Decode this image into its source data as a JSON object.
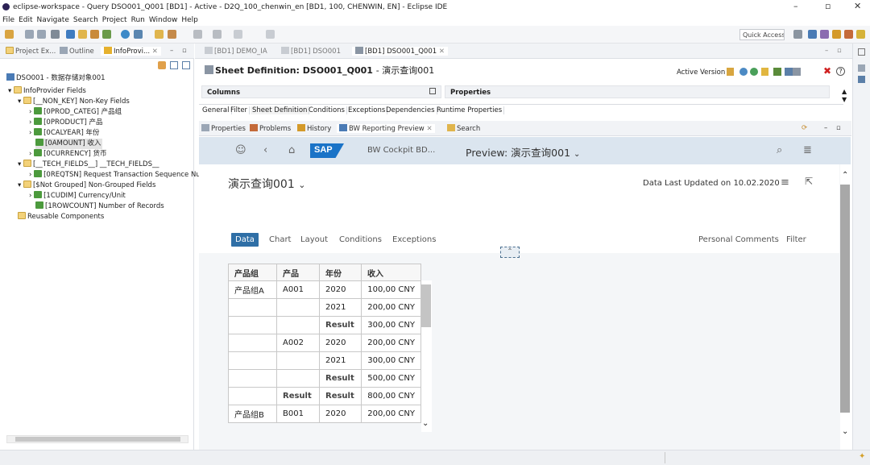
{
  "window": {
    "title": "eclipse-workspace - Query DSO001_Q001 [BD1] - Active - D2Q_100_chenwin_en [BD1, 100, CHENWIN, EN] - Eclipse IDE"
  },
  "menu": [
    "File",
    "Edit",
    "Navigate",
    "Search",
    "Project",
    "Run",
    "Window",
    "Help"
  ],
  "toolbar": {
    "quick_access": "Quick Access"
  },
  "left_tabs": [
    "Project Ex...",
    "Outline",
    "InfoProvi..."
  ],
  "tree": {
    "root": "DSO001 - 数据存储对象001",
    "nodes": [
      {
        "label": "InfoProvider Fields"
      },
      {
        "label": "[__NON_KEY] Non-Key Fields"
      },
      {
        "label": "[0PROD_CATEG] 产品组"
      },
      {
        "label": "[0PRODUCT] 产品"
      },
      {
        "label": "[0CALYEAR] 年份"
      },
      {
        "label": "[0AMOUNT] 收入"
      },
      {
        "label": "[0CURRENCY] 货币"
      },
      {
        "label": "[__TECH_FIELDS__] __TECH_FIELDS__"
      },
      {
        "label": "[0REQTSN] Request Transaction Sequence Nu"
      },
      {
        "label": "[$Not Grouped] Non-Grouped Fields"
      },
      {
        "label": "[1CUDIM] Currency/Unit"
      },
      {
        "label": "[1ROWCOUNT] Number of Records"
      },
      {
        "label": "Reusable Components"
      }
    ]
  },
  "editor_tabs": [
    "[BD1] DEMO_IA",
    "[BD1] DSO001",
    "[BD1] DSO001_Q001"
  ],
  "sheet": {
    "title": "Sheet Definition: DSO001_Q001",
    "subtitle": "- 演示查询001",
    "active_version": "Active Version",
    "columns": "Columns",
    "properties": "Properties"
  },
  "sheet_tabs": [
    "General",
    "Filter",
    "Sheet Definition",
    "Conditions",
    "Exceptions",
    "Dependencies",
    "Runtime Properties"
  ],
  "view_tabs": [
    "Properties",
    "Problems",
    "History",
    "BW Reporting Preview",
    "Search"
  ],
  "preview": {
    "app_name": "BW Cockpit BD...",
    "preview_title": "Preview: 演示查询001",
    "query_title": "演示查询001",
    "data_updated": "Data Last Updated on 10.02.2020",
    "tabs": [
      "Data",
      "Chart",
      "Layout",
      "Conditions",
      "Exceptions"
    ],
    "right_tabs": [
      "Personal Comments",
      "Filter"
    ],
    "table": {
      "headers": [
        "产品组",
        "产品",
        "年份",
        "收入"
      ],
      "rows": [
        [
          "产品组A",
          "A001",
          "2020",
          "100,00 CNY"
        ],
        [
          "",
          "",
          "2021",
          "200,00 CNY"
        ],
        [
          "",
          "",
          "Result",
          "300,00 CNY"
        ],
        [
          "",
          "A002",
          "2020",
          "200,00 CNY"
        ],
        [
          "",
          "",
          "2021",
          "300,00 CNY"
        ],
        [
          "",
          "",
          "Result",
          "500,00 CNY"
        ],
        [
          "",
          "Result",
          "Result",
          "800,00 CNY"
        ],
        [
          "产品组B",
          "B001",
          "2020",
          "200,00 CNY"
        ]
      ]
    }
  },
  "colors": {
    "sap_blue": "#1a73c7",
    "shell_bg": "#dbe5ef",
    "active_tab": "#2f6fa6"
  }
}
